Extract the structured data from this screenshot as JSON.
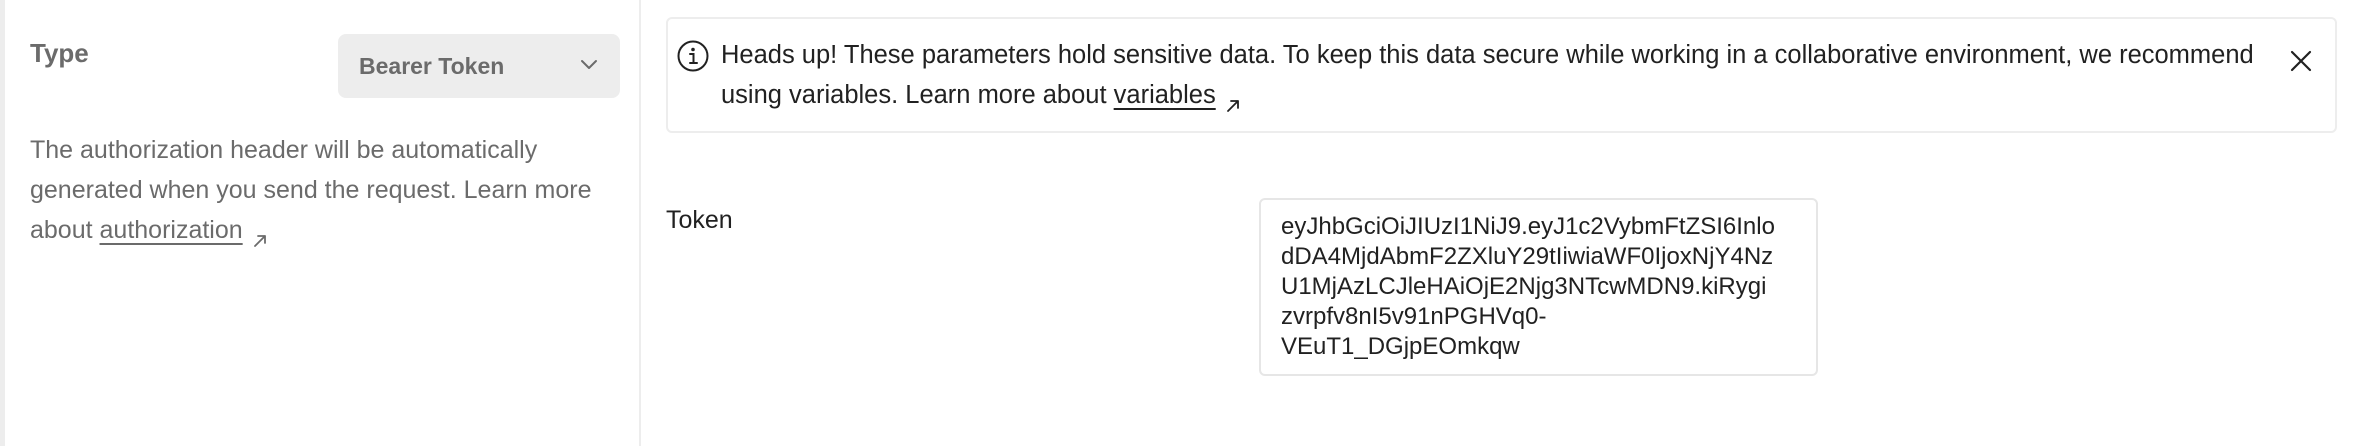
{
  "auth": {
    "type_label": "Type",
    "type_value": "Bearer Token",
    "help_text": "The authorization header will be automatically generated when you send the request. Learn more about ",
    "help_link": "authorization"
  },
  "alert": {
    "text": "Heads up! These parameters hold sensitive data. To keep this data secure while working in a collaborative environment, we recommend using variables. Learn more about ",
    "link": "variables"
  },
  "token": {
    "label": "Token",
    "value": "eyJhbGciOiJIUzI1NiJ9.eyJ1c2VybmFtZSI6Inlo\ndDA4MjdAbmF2ZXluY29tIiwiaWF0IjoxNjY4Nz\nU1MjAzLCJleHAiOjE2Njg3NTcwMDN9.kiRygi\nzvrpfv8nI5v91nPGHVq0-\nVEuT1_DGjpEOmkqw"
  },
  "colors": {
    "muted_text": "#6b6b6b",
    "border": "#ededed",
    "select_bg": "#ededed"
  },
  "icons": [
    "chevron-down-icon",
    "external-link-icon",
    "info-icon",
    "close-icon"
  ]
}
